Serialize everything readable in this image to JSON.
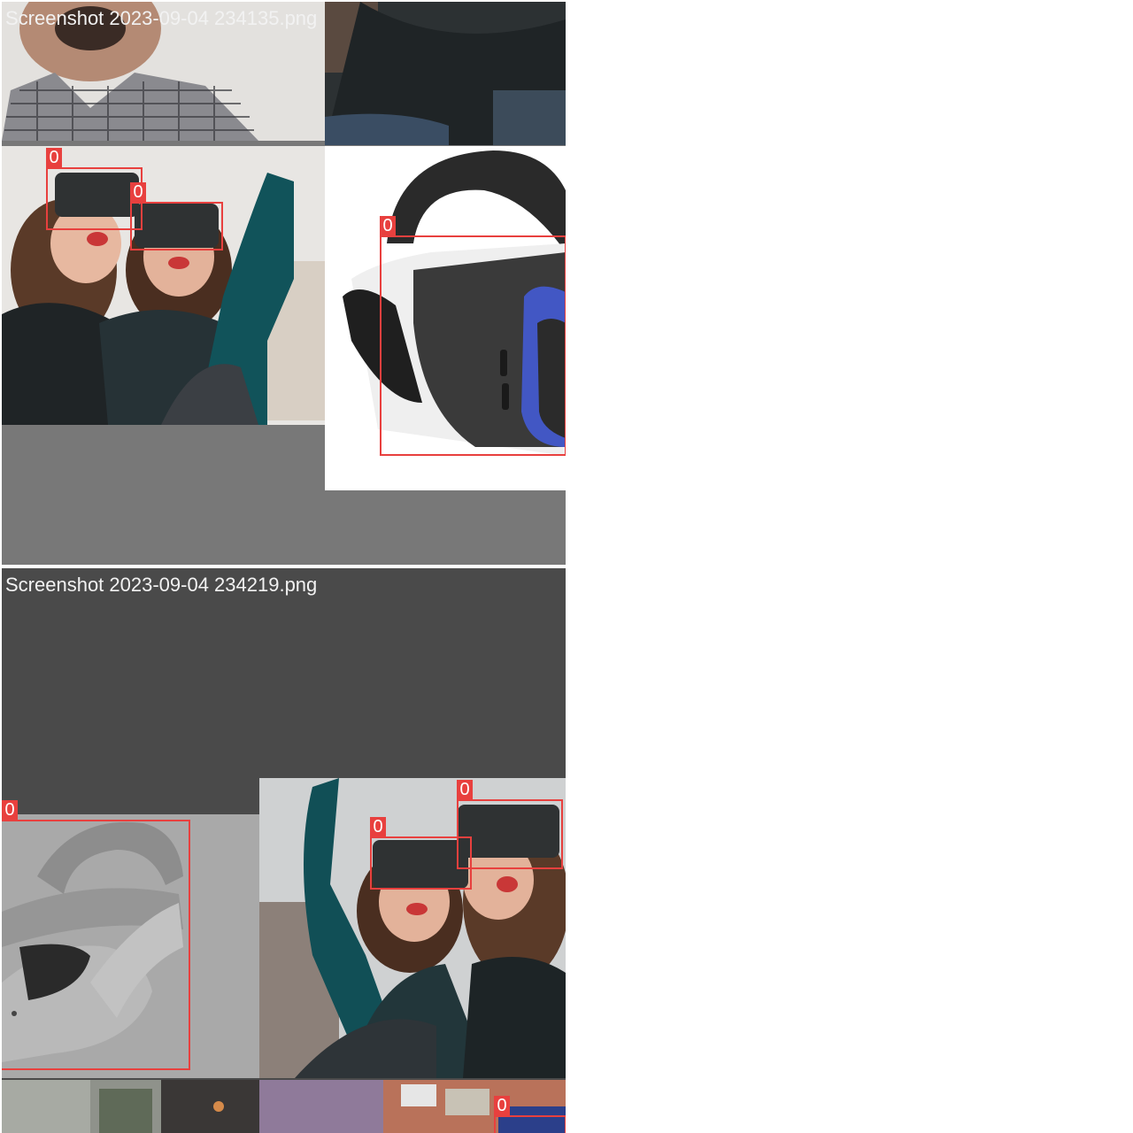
{
  "mosaics": [
    {
      "caption": "Screenshot 2023-09-04 234135.png",
      "tiles": [
        {
          "name": "tile-man-shirt",
          "subject": "man in checkered shirt"
        },
        {
          "name": "tile-woman-sweater",
          "subject": "woman in dark sweater"
        },
        {
          "name": "tile-vr-friends",
          "subject": "two women wearing VR headsets"
        },
        {
          "name": "tile-vr-product",
          "subject": "black and blue VR headset"
        }
      ],
      "detections": [
        {
          "label": "0"
        },
        {
          "label": "0"
        },
        {
          "label": "0"
        }
      ]
    },
    {
      "caption": "Screenshot 2023-09-04 234219.png",
      "tiles": [
        {
          "name": "tile-vr-white",
          "subject": "white VR headset"
        },
        {
          "name": "tile-vr-friends-flipped",
          "subject": "two women wearing VR headsets"
        },
        {
          "name": "tile-office",
          "subject": "office background"
        },
        {
          "name": "tile-brick-wall",
          "subject": "brick wall background"
        }
      ],
      "detections": [
        {
          "label": "0"
        },
        {
          "label": "0"
        },
        {
          "label": "0"
        },
        {
          "label": "0"
        }
      ]
    }
  ],
  "colors": {
    "box": "#e8403e",
    "caption_text": "#f2f2f2",
    "gray_fill": "#777777",
    "dark_fill": "#4a4a4a"
  }
}
